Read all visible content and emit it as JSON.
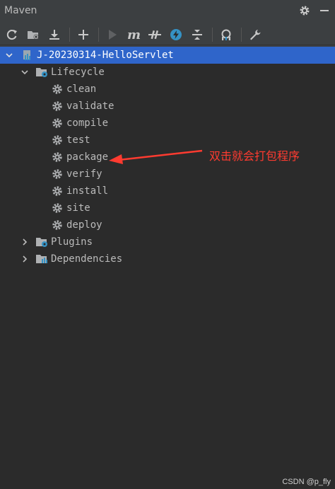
{
  "panel": {
    "title": "Maven"
  },
  "tree": {
    "project": "J-20230314-HelloServlet",
    "lifecycle": {
      "label": "Lifecycle",
      "phases": [
        "clean",
        "validate",
        "compile",
        "test",
        "package",
        "verify",
        "install",
        "site",
        "deploy"
      ]
    },
    "plugins": "Plugins",
    "dependencies": "Dependencies"
  },
  "annotation": {
    "text": "双击就会打包程序"
  },
  "watermark": "CSDN @p_fly",
  "colors": {
    "panel_bg": "#3c3f41",
    "tree_bg": "#2b2b2b",
    "selection": "#2f65ca",
    "annotation": "#ff3b30",
    "accent_blue": "#3592c4"
  },
  "icons": {
    "title_right": [
      "gear-icon",
      "minimize-icon"
    ],
    "toolbar": [
      "reload-icon",
      "folder-icon",
      "download-icon",
      "add-icon",
      "run-icon",
      "maven-goal-icon",
      "skip-tests-icon",
      "offline-icon",
      "collapse-icon",
      "analyze-icon",
      "settings-wrench-icon"
    ]
  }
}
